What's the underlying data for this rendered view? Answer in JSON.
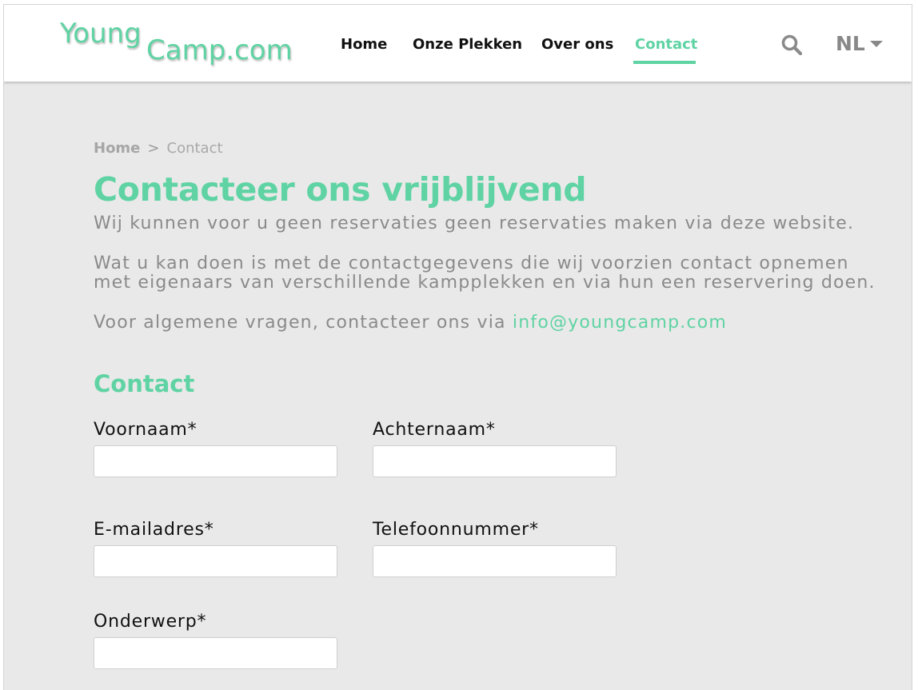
{
  "colors": {
    "accent": "#5fd3a3",
    "text": "#111111",
    "muted": "#8a8a8a",
    "background": "#e9e9e9"
  },
  "header": {
    "logo": {
      "part1": "Young",
      "part2": "Camp.com"
    },
    "nav": [
      {
        "label": "Home",
        "active": false
      },
      {
        "label": "Onze Plekken",
        "active": false
      },
      {
        "label": "Over ons",
        "active": false
      },
      {
        "label": "Contact",
        "active": true
      }
    ],
    "search_icon": "search-icon",
    "language": {
      "label": "NL",
      "icon": "caret-down-icon"
    }
  },
  "breadcrumb": {
    "home": "Home",
    "separator": ">",
    "current": "Contact"
  },
  "main": {
    "title": "Contacteer ons vrijblijvend",
    "paragraph1": "Wij kunnen voor u geen reservaties geen reservaties maken via deze website.",
    "paragraph2_line1": "Wat u kan doen is met de contactgegevens die wij voorzien contact opnemen",
    "paragraph2_line2": "met eigenaars van verschillende kampplekken en via hun een reservering doen.",
    "paragraph3_prefix": "Voor algemene vragen, contacteer ons via ",
    "email": "info@youngcamp.com"
  },
  "form": {
    "title": "Contact",
    "fields": {
      "first_name": {
        "label": "Voornaam*",
        "value": "",
        "placeholder": ""
      },
      "last_name": {
        "label": "Achternaam*",
        "value": "",
        "placeholder": ""
      },
      "email": {
        "label": "E-mailadres*",
        "value": "",
        "placeholder": ""
      },
      "phone": {
        "label": "Telefoonnummer*",
        "value": "",
        "placeholder": ""
      },
      "subject": {
        "label": "Onderwerp*",
        "value": "",
        "placeholder": ""
      }
    }
  }
}
